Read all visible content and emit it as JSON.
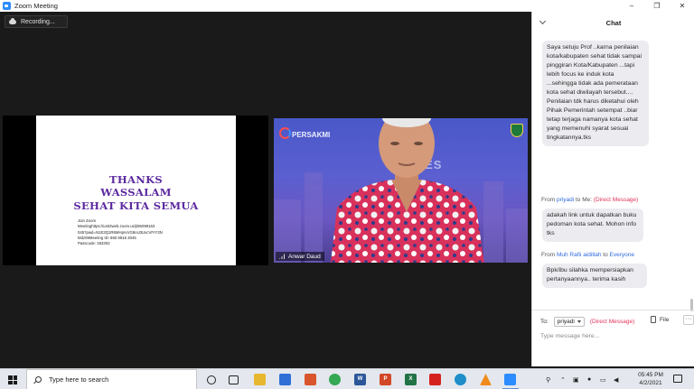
{
  "window": {
    "title": "Zoom Meeting",
    "controls": [
      "–",
      "❐",
      "✕"
    ]
  },
  "recording": {
    "label": "Recording..."
  },
  "slide": {
    "headings": [
      "THANKS",
      "WASSALAM",
      "SEHAT KITA SEMUA"
    ],
    "info_lines": [
      "Join Zoom",
      "Meetinghttps://us02web.zoom.us/j/86099163",
      "045?pwd=N1E3Q1R6MHprvVG8oU3UxcVFrY3N",
      "Mdz09Meeting ID: 860 9916 3045",
      "Passcode: 263302"
    ]
  },
  "speaker": {
    "name": "Anwar Daud",
    "logo_text": "PERSAKMI",
    "banner_text": "LITIES"
  },
  "chat": {
    "title": "Chat",
    "messages": [
      {
        "text": "Saya setuju Prof ..karna penilaian kota/kabupaten sehat tidak sampai pinggiran Kota/Kabupaten ...tapi lebih focus ke induk kota ...sehingga tidak ada pemerataan kota sehat diwilayah tersebut.... Penilaian tdk harus diketahui oleh Pihak Pemerintah setempat ..biar tetap terjaga namanya kota sehat yang memenuhi syarat sesuai tingkatannya.tks"
      },
      {
        "from_label": "From",
        "from": "priyadi",
        "to_label": "to",
        "to": "Me:",
        "tag": "(Direct Message)",
        "text": "adakah link untuk dapatkan buku pedoman kota sehat. Mohon info tks"
      },
      {
        "from_label": "From",
        "from": "Muh Rafii aidillah",
        "to_label": "to",
        "to": "Everyone",
        "text": "Bpk/ibu silahka mempersiapkan pertanyaannya.. terima kasih"
      }
    ],
    "to_label": "To:",
    "recipient": "priyadi",
    "recipient_tag": "(Direct Message)",
    "file_label": "File",
    "more_label": "···",
    "input_placeholder": "Type message here..."
  },
  "taskbar": {
    "search_placeholder": "Type here to search",
    "time": "05:45 PM",
    "date": "4/2/2021"
  }
}
